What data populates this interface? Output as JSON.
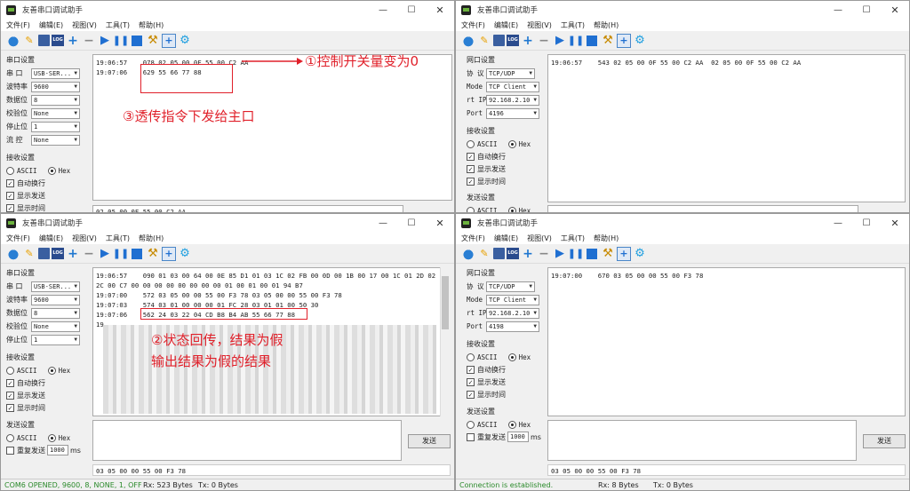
{
  "app": {
    "title": "友善串口调试助手",
    "menu": [
      "文件(F)",
      "编辑(E)",
      "视图(V)",
      "工具(T)",
      "帮助(H)"
    ],
    "controls": {
      "minimize": "—",
      "maximize": "☐",
      "close": "✕"
    },
    "send_button": "发送"
  },
  "labels": {
    "serial_settings": "串口设置",
    "port": "串  口",
    "baud": "波特率",
    "databits": "数据位",
    "parity": "校验位",
    "stopbits": "停止位",
    "flow": "流  控",
    "recv_settings": "接收设置",
    "send_settings": "发送设置",
    "ascii": "ASCII",
    "hex": "Hex",
    "auto_wrap": "自动换行",
    "show_send": "显示发送",
    "show_time": "显示时间",
    "repeat_send": "重复发送",
    "ms": "ms",
    "net_settings": "网口设置",
    "proto": "协  议",
    "mode": "Mode",
    "remote_ip": "rt IP",
    "port_net": "Port"
  },
  "serial_values": {
    "port": "USB-SER...",
    "baud": "9600",
    "databits": "8",
    "parity": "None",
    "stopbits": "1",
    "flow": "None"
  },
  "net_values_top": {
    "proto": "TCP/UDP",
    "mode": "TCP Client",
    "ip": "92.168.2.10",
    "port": "4196"
  },
  "net_values_bottom": {
    "proto": "TCP/UDP",
    "mode": "TCP Client",
    "ip": "92.168.2.10",
    "port": "4198",
    "repeat_ms": "1000"
  },
  "windows": {
    "top_left": {
      "recv_lines": [
        "19:06:57    078 02 05 00 0F 55 00 C2 AA",
        "19:07:06    629 55 66 77 88"
      ],
      "send_text": "02 05 00 0F 55 00 C2 AA"
    },
    "top_right": {
      "recv_lines": [
        "19:06:57    543 02 05 00 0F 55 00 C2 AA  02 05 00 0F 55 00 C2 AA"
      ]
    },
    "bottom_left": {
      "recv_lines": [
        "19:06:57    090 01 03 00 64 00 0E 85 D1 01 03 1C 02 FB 00 0D 00 1B 00 17 00 1C 01 2D 02",
        "2C 00 C7 00 00 00 00 00 00 00 00 01 00 01 00 01 94 B7",
        "19:07:00    572 03 05 00 00 55 00 F3 78 03 05 00 00 55 00 F3 78",
        "19:07:03    574 03 01 00 00 00 01 FC 28 03 01 01 00 50 30",
        "19:07:06    562 24 03 22 04 CD B8 B4 AB 55 66 77 88",
        "19"
      ],
      "send_text": "03 05 00 00 55 00 F3 78",
      "repeat_ms": "1000",
      "status": "COM6 OPENED, 9600, 8, NONE, 1, OFF",
      "rx": "Rx: 523 Bytes",
      "tx": "Tx: 0 Bytes"
    },
    "bottom_right": {
      "recv_lines": [
        "19:07:00    670 03 05 00 00 55 00 F3 78"
      ],
      "send_text": "03 05 00 00 55 00 F3 78",
      "status": "Connection is established.",
      "rx": "Rx: 8 Bytes",
      "tx": "Tx: 0 Bytes"
    }
  },
  "annotations": {
    "a1": "①控制开关量变为0",
    "a3": "③透传指令下发给主口",
    "a2_line1": "②状态回传，结果为假",
    "a2_line2": "输出结果为假的结果"
  },
  "colors": {
    "annotation": "#e0202a",
    "status_ok": "#2a8a2a",
    "toolbar_accent": "#1f6fd1"
  }
}
